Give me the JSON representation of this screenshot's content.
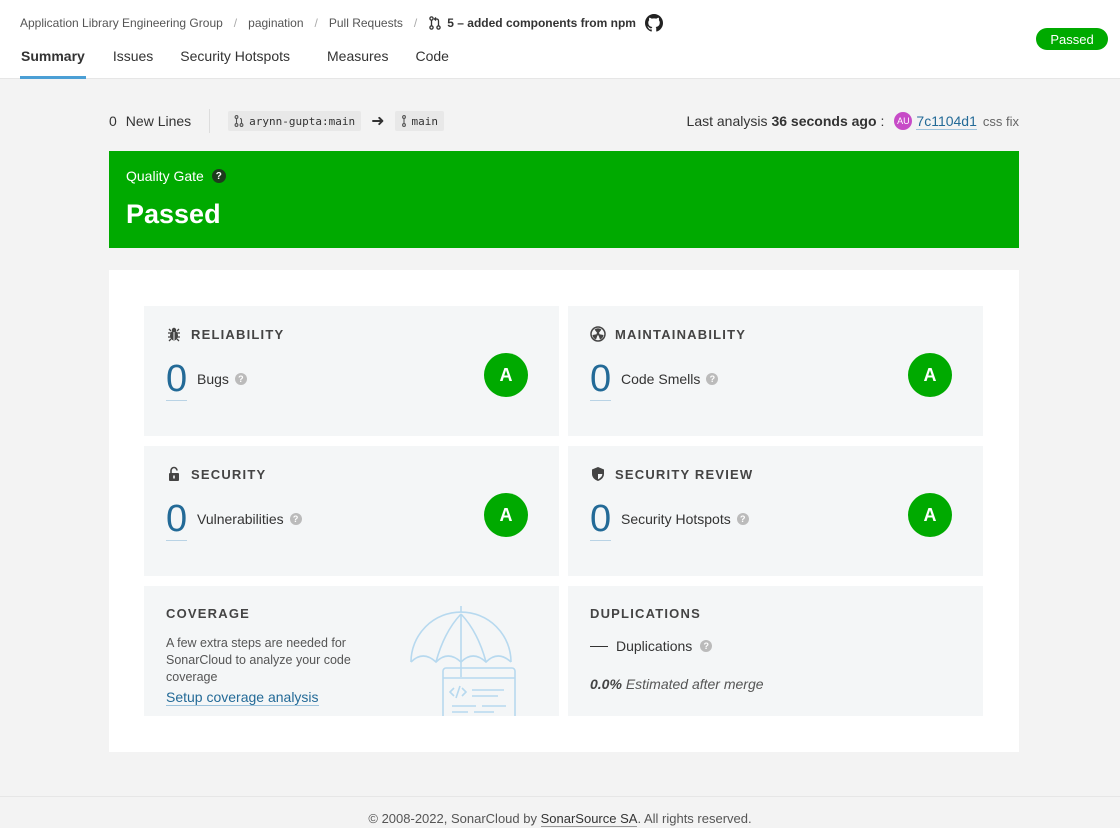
{
  "breadcrumb": {
    "organization": "Application Library Engineering Group",
    "project": "pagination",
    "section": "Pull Requests",
    "pull_request": "5 – added components from npm"
  },
  "status_badge": "Passed",
  "tabs": [
    "Summary",
    "Issues",
    "Security Hotspots",
    "Measures",
    "Code"
  ],
  "meta": {
    "new_lines_count": "0",
    "new_lines_label": "New Lines",
    "source_branch": "arynn-gupta:main",
    "target_branch": "main",
    "last_analysis_prefix": "Last analysis",
    "last_analysis_time": "36 seconds ago",
    "avatar_initials": "AU",
    "commit_hash": "7c1104d1",
    "commit_message": "css fix"
  },
  "quality_gate": {
    "label": "Quality Gate",
    "help": "?",
    "status": "Passed"
  },
  "cards": {
    "reliability": {
      "title": "RELIABILITY",
      "value": "0",
      "label": "Bugs",
      "rating": "A"
    },
    "maintainability": {
      "title": "MAINTAINABILITY",
      "value": "0",
      "label": "Code Smells",
      "rating": "A"
    },
    "security": {
      "title": "SECURITY",
      "value": "0",
      "label": "Vulnerabilities",
      "rating": "A"
    },
    "security_review": {
      "title": "SECURITY REVIEW",
      "value": "0",
      "label": "Security Hotspots",
      "rating": "A"
    },
    "coverage": {
      "title": "COVERAGE",
      "text": "A few extra steps are needed for SonarCloud to analyze your code coverage",
      "link": "Setup coverage analysis"
    },
    "duplications": {
      "title": "DUPLICATIONS",
      "label": "Duplications",
      "estimate_value": "0.0%",
      "estimate_label": "Estimated after merge"
    }
  },
  "colors": {
    "passed": "#00aa00",
    "link": "#236a97",
    "tab_active": "#4b9fd5"
  },
  "footer": {
    "prefix": "© 2008-2022, SonarCloud by",
    "company": "SonarSource SA",
    "suffix": ". All rights reserved."
  }
}
